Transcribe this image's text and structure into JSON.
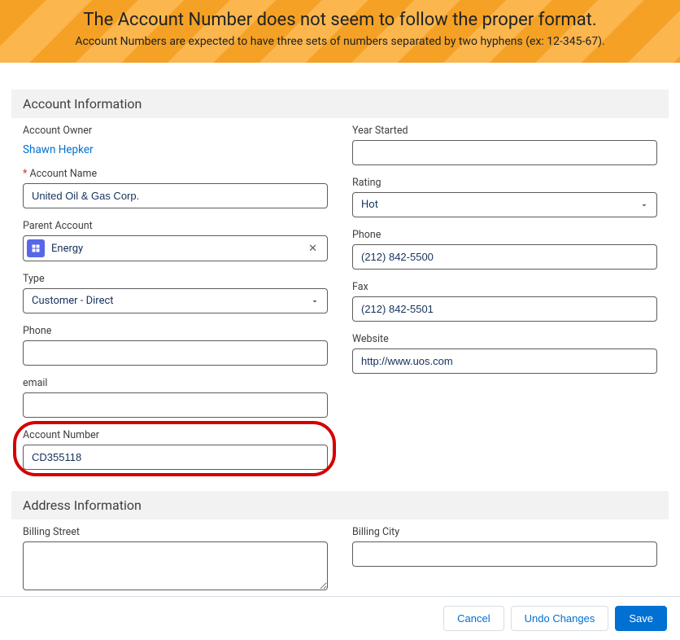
{
  "banner": {
    "title": "The Account Number does not seem to follow the proper format.",
    "subtitle": "Account Numbers are expected to have three sets of numbers separated by two hyphens (ex: 12-345-67)."
  },
  "sections": {
    "account_info": "Account Information",
    "address_info": "Address Information"
  },
  "fields": {
    "account_owner": {
      "label": "Account Owner",
      "value": "Shawn Hepker"
    },
    "account_name": {
      "label": "Account Name",
      "value": "United Oil & Gas Corp."
    },
    "parent_account": {
      "label": "Parent Account",
      "value": "Energy"
    },
    "type": {
      "label": "Type",
      "value": "Customer - Direct"
    },
    "phone_left": {
      "label": "Phone",
      "value": ""
    },
    "email": {
      "label": "email",
      "value": ""
    },
    "account_number": {
      "label": "Account Number",
      "value": "CD355118"
    },
    "year_started": {
      "label": "Year Started",
      "value": ""
    },
    "rating": {
      "label": "Rating",
      "value": "Hot"
    },
    "phone_right": {
      "label": "Phone",
      "value": "(212) 842-5500"
    },
    "fax": {
      "label": "Fax",
      "value": "(212) 842-5501"
    },
    "website": {
      "label": "Website",
      "value": "http://www.uos.com"
    },
    "billing_street": {
      "label": "Billing Street",
      "value": ""
    },
    "billing_city": {
      "label": "Billing City",
      "value": ""
    }
  },
  "footer": {
    "cancel": "Cancel",
    "undo": "Undo Changes",
    "save": "Save"
  },
  "icons": {
    "clear": "✕"
  }
}
